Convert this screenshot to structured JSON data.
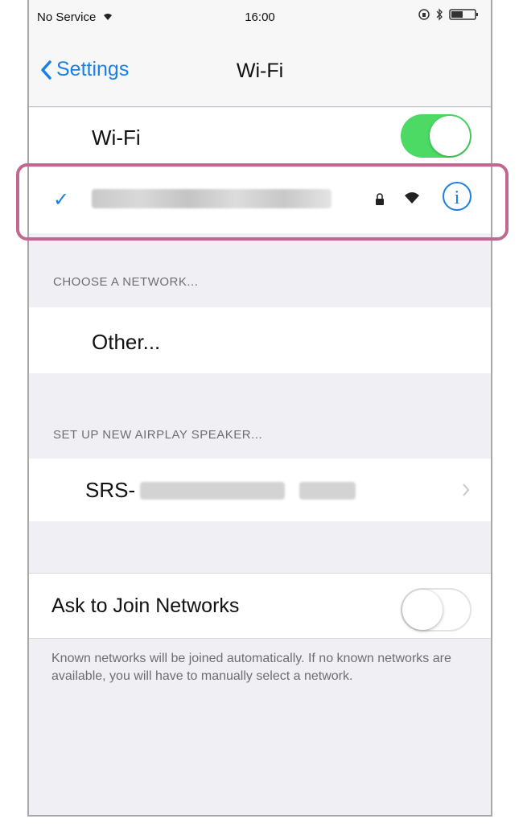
{
  "status_bar": {
    "carrier": "No Service",
    "time": "16:00"
  },
  "nav": {
    "back_label": "Settings",
    "title": "Wi-Fi"
  },
  "wifi_toggle": {
    "label": "Wi-Fi",
    "state": "on"
  },
  "connected_network": {
    "checkmark": "✓",
    "name": "",
    "info": "i"
  },
  "choose_network": {
    "header": "CHOOSE A NETWORK...",
    "other_label": "Other..."
  },
  "airplay": {
    "header": "SET UP NEW AIRPLAY SPEAKER...",
    "speaker_prefix": "SRS-"
  },
  "ask_to_join": {
    "label": "Ask to Join Networks",
    "state": "off",
    "footer": "Known networks will be joined automatically. If no known networks are available, you will have to manually select a network."
  },
  "colors": {
    "accent": "#1a7fe6",
    "toggle_on": "#4cd964",
    "highlight": "#c2678f"
  }
}
